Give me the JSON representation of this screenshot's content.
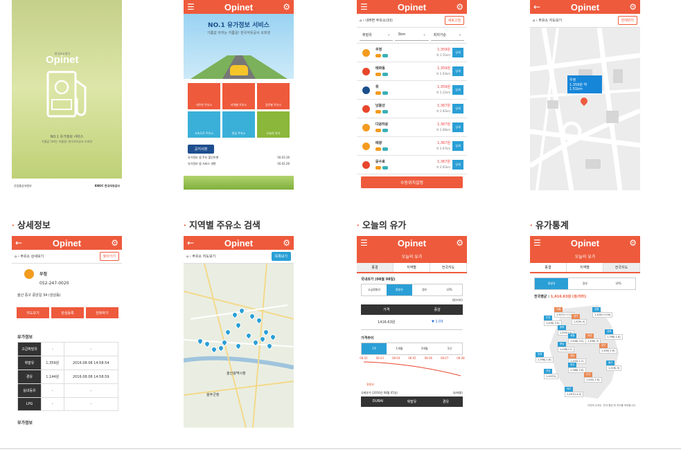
{
  "splash": {
    "logo": "Opinet",
    "small_logo": "한국유소찾기",
    "tagline1": "NO.1 유가정보 서비스",
    "tagline2": "가름값 아끼는 지름길! 한국석유공사 오피넷",
    "footer_left": "산업통상자원부",
    "footer_right": "KNOC 한국석유공사"
  },
  "home": {
    "logo": "Opinet",
    "headline": "NO.1 유가정보 서비스",
    "subline": "기름값 아끼는 지름길! 한국석유공사 오피넷",
    "tiles": [
      "내주변 주유소",
      "지역별 주유소",
      "경로별 주유소",
      "고속도로 주유소",
      "관심 주유소",
      "오늘의 유가"
    ],
    "notice_btn": "공지사항",
    "notices": [
      {
        "t": "유가정보 앱 주유 할인이벤",
        "d": "16.03.16"
      },
      {
        "t": "유가정보 앱 서비스 개편",
        "d": "16.02.26"
      }
    ]
  },
  "list": {
    "logo": "Opinet",
    "crumb": "내주변 주유소(33)",
    "refresh": "새로고침",
    "filters": [
      "휘발유",
      "3km",
      "최저가순"
    ],
    "rows": [
      {
        "n": "우정",
        "p": "1,359원",
        "d": "약 1.51km"
      },
      {
        "n": "태화동",
        "p": "1,359원",
        "d": "약 2.93km"
      },
      {
        "n": "휘",
        "p": "1,359원",
        "d": "약 2.22km"
      },
      {
        "n": "남울산",
        "p": "1,367원",
        "d": "약 1.92km"
      },
      {
        "n": "다운타운",
        "p": "1,367원",
        "d": "약 2.08km"
      },
      {
        "n": "태광",
        "p": "1,367원",
        "d": "약 2.67km"
      },
      {
        "n": "문수로",
        "p": "1,367원",
        "d": "약 2.65km"
      }
    ],
    "detail_btn": "상세",
    "bottom_btn": "수동위치설정"
  },
  "map1": {
    "logo": "Opinet",
    "crumb": "주유소 지도보기",
    "btn": "현재위치",
    "popup_name": "우정",
    "popup_info": "1,359원 약 1.51km"
  },
  "captions": [
    "상세정보",
    "지역별 주유소 검색",
    "오늘의 유가",
    "유가통계"
  ],
  "detail": {
    "logo": "Opinet",
    "crumb": "주유소 상세보기",
    "btn": "찾아가기",
    "name": "우정",
    "phone": "052-247-0020",
    "addr": "울산 중구 중앙길 34 (성남동)",
    "actions": [
      "지도보기",
      "관심등록",
      "전화하기"
    ],
    "section": "유가정보",
    "table": [
      [
        "고급휘발유",
        "-",
        "-"
      ],
      [
        "휘발유",
        "1,359원",
        "2016.08.08 14:58:54"
      ],
      [
        "경유",
        "1,144원",
        "2016.08.08 14:58:59"
      ],
      [
        "실내등유",
        "-",
        "-"
      ],
      [
        "LPG",
        "-",
        "-"
      ]
    ],
    "section2": "부가정보"
  },
  "region": {
    "logo": "Opinet",
    "crumb": "주유소 지도보기",
    "btn": "목록보기",
    "city": "울산광역시청",
    "area": "울주군청"
  },
  "today": {
    "logo": "Opinet",
    "title": "오늘의 유가",
    "tabs": [
      "종결",
      "지역별",
      "전국지도"
    ],
    "domestic": "국내유가 (08월 08일)",
    "fuel_tabs": [
      "고급휘발유",
      "휘발유",
      "경유",
      "LPG"
    ],
    "unit": "(원/리터)",
    "th": [
      "가격",
      "증감"
    ],
    "price": "1416.63원",
    "change": "▼ 1.09",
    "trend": "가격추이",
    "periods": [
      "1주",
      "1개월",
      "3개월",
      "1년"
    ],
    "dates": [
      "08.02",
      "08.03",
      "08.04",
      "08.05",
      "08.06",
      "08.07",
      "08.08"
    ],
    "legend": "휘발유",
    "intl": "국제유가 (2016년 08월 05일)",
    "intl_unit": "($/배럴)",
    "intl_th": [
      "DUBAI",
      "휘발유",
      "경유"
    ]
  },
  "stats": {
    "logo": "Opinet",
    "title": "오늘의 유가",
    "tabs": [
      "종결",
      "지역별",
      "전국지도"
    ],
    "fuel_tabs": [
      "휘발유",
      "경유",
      "LPG"
    ],
    "avg_label": "전국평균 :",
    "avg_value": "1,416.63원 (원/리터)",
    "regions": [
      {
        "n": "서울",
        "v": "1,527(+1.11)"
      },
      {
        "n": "강원",
        "v": "1,420(+0.16)"
      },
      {
        "n": "인천",
        "v": "1,426(-3.0)"
      },
      {
        "n": "경기",
        "v": "1,420(-4)"
      },
      {
        "n": "충북",
        "v": "1,425(+5)"
      },
      {
        "n": "세종",
        "v": "1,406(-3.0)"
      },
      {
        "n": "대전",
        "v": "1,406(-3)"
      },
      {
        "n": "경북",
        "v": "1,398(-1.8)"
      },
      {
        "n": "충남",
        "v": "1,408(+2)"
      },
      {
        "n": "대구",
        "v": "1,400(-1.6)"
      },
      {
        "n": "전북",
        "v": "1,398(-1.8)"
      },
      {
        "n": "전남",
        "v": "1,407(5)"
      },
      {
        "n": "경남",
        "v": "1,404(-1.2)"
      },
      {
        "n": "울산",
        "v": "1,416(-3)"
      },
      {
        "n": "광주",
        "v": "1,388(-2.8)"
      },
      {
        "n": "부산",
        "v": "1,402(-1.6)"
      },
      {
        "n": "제주",
        "v": "1,457(+4.0)"
      }
    ],
    "note": "다만의 수치는 '전국 평균'과 차이를 의미합니다."
  }
}
